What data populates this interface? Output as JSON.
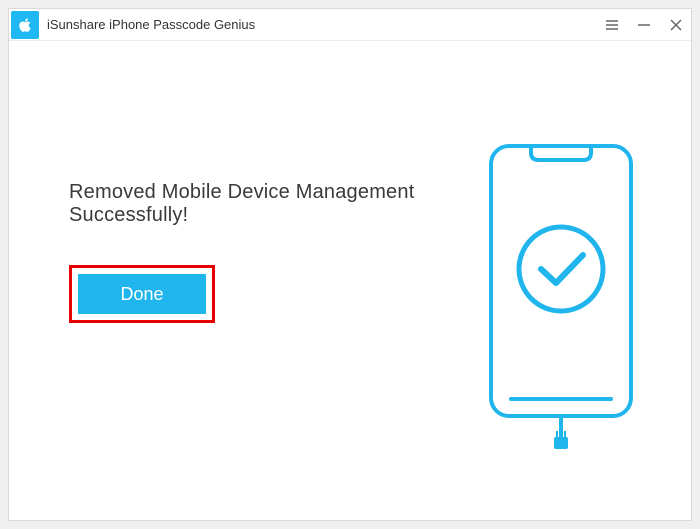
{
  "titlebar": {
    "app_title": "iSunshare iPhone Passcode Genius"
  },
  "main": {
    "headline": "Removed Mobile Device Management Successfully!",
    "done_label": "Done"
  },
  "colors": {
    "accent": "#20b6ed",
    "highlight_border": "#e60000"
  }
}
